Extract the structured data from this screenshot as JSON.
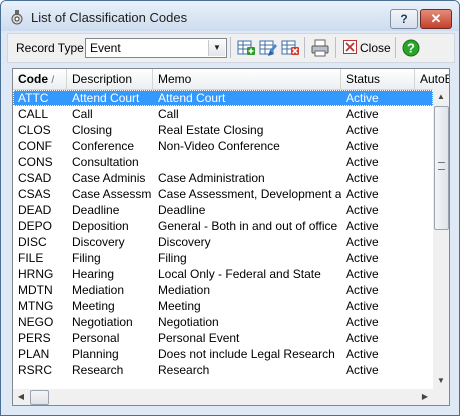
{
  "window": {
    "title": "List of Classification Codes",
    "help_label": "?",
    "close_label": "✕"
  },
  "toolbar": {
    "record_type_label": "Record Type",
    "record_type_value": "Event",
    "close_label": "Close",
    "icons": [
      "add-record-icon",
      "edit-record-icon",
      "delete-record-icon",
      "print-icon",
      "close-icon",
      "help-icon"
    ]
  },
  "grid": {
    "columns": [
      "Code",
      "Description",
      "Memo",
      "Status",
      "AutoE"
    ],
    "sort_indicator": "/",
    "rows": [
      {
        "code": "ATTC",
        "description": "Attend Court",
        "memo": "Attend Court",
        "status": "Active",
        "selected": true
      },
      {
        "code": "CALL",
        "description": "Call",
        "memo": "Call",
        "status": "Active"
      },
      {
        "code": "CLOS",
        "description": "Closing",
        "memo": "Real Estate Closing",
        "status": "Active"
      },
      {
        "code": "CONF",
        "description": "Conference",
        "memo": "Non-Video Conference",
        "status": "Active"
      },
      {
        "code": "CONS",
        "description": "Consultation",
        "memo": "",
        "status": "Active"
      },
      {
        "code": "CSAD",
        "description": "Case Adminis",
        "memo": "Case Administration",
        "status": "Active"
      },
      {
        "code": "CSAS",
        "description": "Case Assessm",
        "memo": "Case Assessment, Development a",
        "status": "Active"
      },
      {
        "code": "DEAD",
        "description": "Deadline",
        "memo": "Deadline",
        "status": "Active"
      },
      {
        "code": "DEPO",
        "description": "Deposition",
        "memo": "General - Both in and out of office",
        "status": "Active"
      },
      {
        "code": "DISC",
        "description": "Discovery",
        "memo": "Discovery",
        "status": "Active"
      },
      {
        "code": "FILE",
        "description": "Filing",
        "memo": "Filing",
        "status": "Active"
      },
      {
        "code": "HRNG",
        "description": "Hearing",
        "memo": "Local Only - Federal and State",
        "status": "Active"
      },
      {
        "code": "MDTN",
        "description": "Mediation",
        "memo": "Mediation",
        "status": "Active"
      },
      {
        "code": "MTNG",
        "description": "Meeting",
        "memo": "Meeting",
        "status": "Active"
      },
      {
        "code": "NEGO",
        "description": "Negotiation",
        "memo": "Negotiation",
        "status": "Active"
      },
      {
        "code": "PERS",
        "description": "Personal",
        "memo": "Personal Event",
        "status": "Active"
      },
      {
        "code": "PLAN",
        "description": "Planning",
        "memo": "Does not include Legal Research",
        "status": "Active"
      },
      {
        "code": "RSRC",
        "description": "Research",
        "memo": "Research",
        "status": "Active"
      }
    ]
  }
}
